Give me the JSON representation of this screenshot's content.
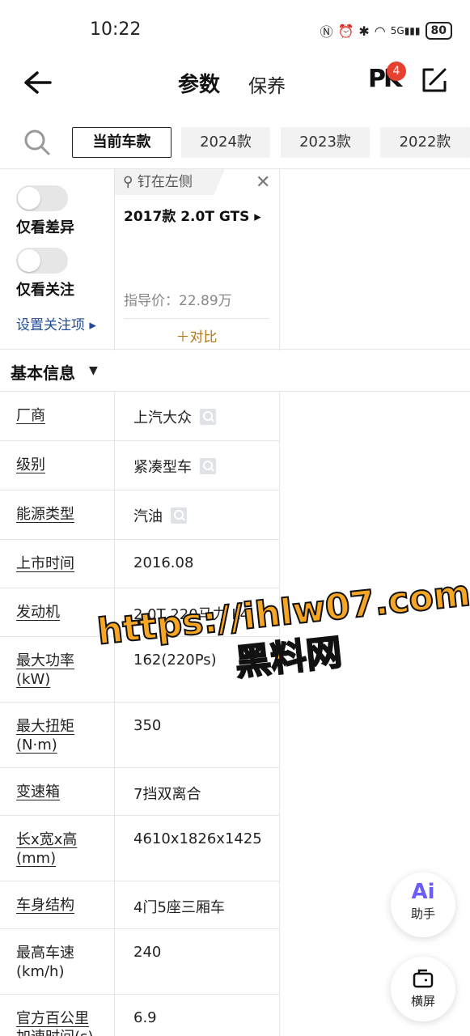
{
  "status": {
    "time": "10:22",
    "battery": "80",
    "network": "5G"
  },
  "header": {
    "tab_params": "参数",
    "tab_maintenance": "保养",
    "pk_label": "PK",
    "pk_badge": "4"
  },
  "year_tabs": [
    "当前车款",
    "2024款",
    "2023款",
    "2022款"
  ],
  "filters": {
    "diff_only": "仅看差异",
    "focus_only": "仅看关注",
    "set_focus": "设置关注项 ▸"
  },
  "car": {
    "pin_label": "钉在左侧",
    "name": "2017款 2.0T GTS ▸",
    "price": "指导价：22.89万",
    "compare": "＋对比"
  },
  "section": {
    "title": "基本信息"
  },
  "rows": [
    {
      "label": "厂商",
      "value": "上汽大众"
    },
    {
      "label": "级别",
      "value": "紧凑型车"
    },
    {
      "label": "能源类型",
      "value": "汽油"
    },
    {
      "label": "上市时间",
      "value": "2016.08"
    },
    {
      "label": "发动机",
      "value": "2.0T 220马力 L4"
    },
    {
      "label": "最大功率(kW)",
      "value": "162(220Ps)"
    },
    {
      "label": "最大扭矩(N·m)",
      "value": "350"
    },
    {
      "label": "变速箱",
      "value": "7挡双离合"
    },
    {
      "label": "长x宽x高(mm)",
      "value": "4610x1826x1425"
    },
    {
      "label": "车身结构",
      "value": "4门5座三厢车"
    },
    {
      "label": "最高车速(km/h)",
      "value": "240"
    },
    {
      "label": "官方百公里加速时间(s)",
      "value": "6.9"
    }
  ],
  "watermark": {
    "line1": "https://ihlw07.com",
    "line2": "黑料网"
  },
  "fab": {
    "ai_glyph": "Ai",
    "ai_label": "助手",
    "landscape_label": "横屏"
  }
}
